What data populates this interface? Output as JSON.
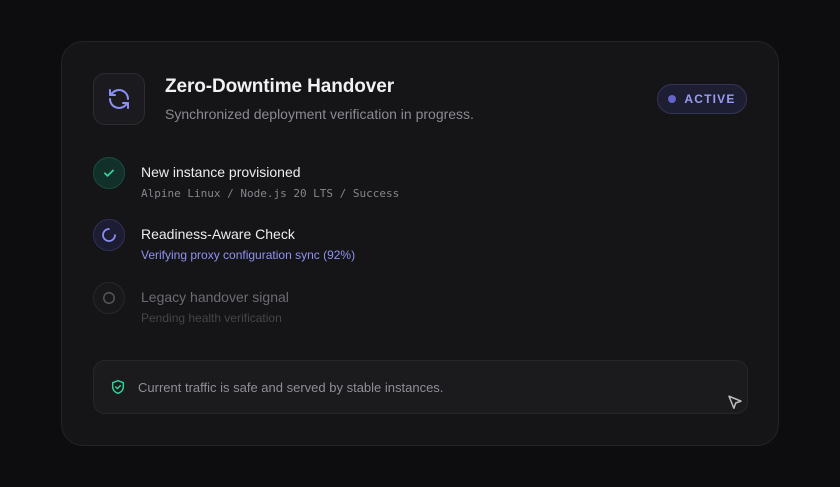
{
  "header": {
    "title": "Zero-Downtime Handover",
    "subtitle": "Synchronized deployment verification in progress.",
    "icon": "refresh-icon",
    "badge": "ACTIVE"
  },
  "steps": [
    {
      "title": "New instance provisioned",
      "subtitle": "Alpine Linux / Node.js 20 LTS / Success",
      "state": "complete",
      "icon": "check-icon"
    },
    {
      "title": "Readiness-Aware Check",
      "subtitle": "Verifying proxy configuration sync (92%)",
      "state": "in-progress",
      "progress": 92,
      "icon": "spinner-icon"
    },
    {
      "title": "Legacy handover signal",
      "subtitle": "Pending health verification",
      "state": "pending",
      "icon": "circle-icon"
    }
  ],
  "footer": {
    "text": "Current traffic is safe and served by stable instances.",
    "icon": "shield-check-icon"
  },
  "colors": {
    "accent": "#8b8ef5",
    "success": "#34d399",
    "background": "#0d0d0f",
    "card": "#151517"
  }
}
